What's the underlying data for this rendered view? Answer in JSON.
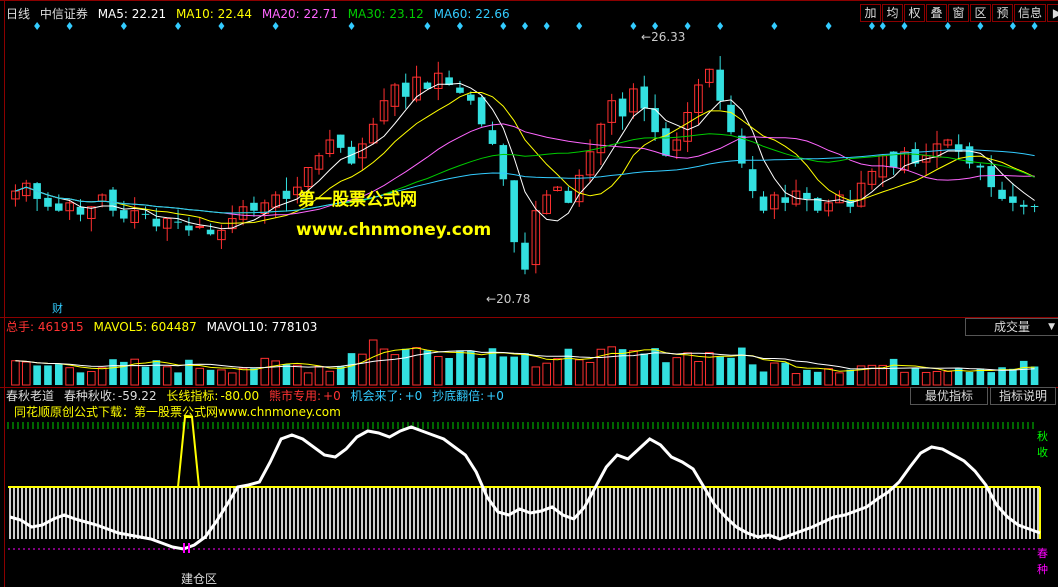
{
  "header": {
    "period": "日线",
    "stock": "中信证券",
    "ma": [
      {
        "label": "MA5: 22.21",
        "color": "#ffffff"
      },
      {
        "label": "MA10: 22.44",
        "color": "#ffff00"
      },
      {
        "label": "MA20: 22.71",
        "color": "#ff66ff"
      },
      {
        "label": "MA30: 23.12",
        "color": "#00cc00"
      },
      {
        "label": "MA60: 22.66",
        "color": "#33ccff"
      }
    ]
  },
  "toolbar": [
    "加",
    "均",
    "权",
    "叠",
    "窗",
    "区",
    "预",
    "信息",
    "▶"
  ],
  "watermark": {
    "line1": "第一股票公式网",
    "line2": "www.chnmoney.com"
  },
  "price_marks": {
    "high": "26.33",
    "low": "20.78",
    "cai": "财"
  },
  "volume": {
    "total_label": "总手:",
    "total_value": "461915",
    "mavol5": "MAVOL5: 604487",
    "mavol10": "MAVOL10: 778103",
    "combo": "成交量",
    "combo_arrow": "▼"
  },
  "indicator": {
    "name": "春秋老道",
    "chunzhong_label": "春种秋收:",
    "chunzhong_value": "-59.22",
    "longline_label": "长线指标:",
    "longline_value": "-80.00",
    "bear_label": "熊市专用:",
    "bear_value": "+0",
    "chance_label": "机会来了:",
    "chance_value": "+0",
    "bottom_label": "抄底翻倍:",
    "bottom_value": "+0",
    "download": "同花顺原创公式下载：第一股票公式网www.chnmoney.com",
    "best_button": "最优指标",
    "explain_button": "指标说明",
    "qiushou_label": "秋收",
    "chunzhong_side": "春种",
    "jiancang": "建仓区"
  },
  "chart_data": {
    "type": "candlestick",
    "price_ylim": [
      20.0,
      27.0
    ],
    "high_point": 26.33,
    "low_point": 20.78,
    "candles_count": 95,
    "close": [
      22.9,
      23.1,
      22.7,
      22.5,
      22.4,
      22.6,
      22.3,
      22.5,
      22.8,
      22.4,
      22.2,
      22.4,
      22.3,
      22.0,
      22.2,
      22.1,
      21.9,
      22.0,
      21.8,
      21.9,
      22.2,
      22.5,
      22.4,
      22.6,
      22.8,
      22.7,
      23.0,
      23.5,
      23.8,
      24.2,
      24.0,
      23.6,
      24.1,
      24.6,
      25.2,
      25.6,
      25.3,
      25.8,
      25.5,
      25.9,
      25.6,
      25.4,
      25.2,
      24.6,
      24.1,
      23.2,
      21.6,
      20.9,
      22.4,
      22.8,
      23.0,
      22.6,
      23.3,
      23.9,
      24.6,
      25.2,
      24.8,
      25.5,
      25.0,
      24.4,
      23.8,
      24.2,
      24.9,
      25.6,
      26.0,
      25.2,
      24.4,
      23.6,
      22.9,
      22.4,
      22.8,
      22.6,
      22.9,
      22.7,
      22.4,
      22.6,
      22.8,
      22.5,
      23.1,
      23.4,
      23.8,
      23.5,
      23.9,
      23.6,
      23.8,
      24.1,
      24.2,
      23.9,
      23.6,
      23.5,
      23.0,
      22.7,
      22.6,
      22.5,
      22.5
    ],
    "mavol": {
      "mavol5": 604487,
      "mavol10": 778103,
      "total": 461915
    },
    "indicator_values": {
      "chunzhong": -59.22,
      "longline": -80.0,
      "bear": 0,
      "chance": 0,
      "bottom": 0
    }
  }
}
